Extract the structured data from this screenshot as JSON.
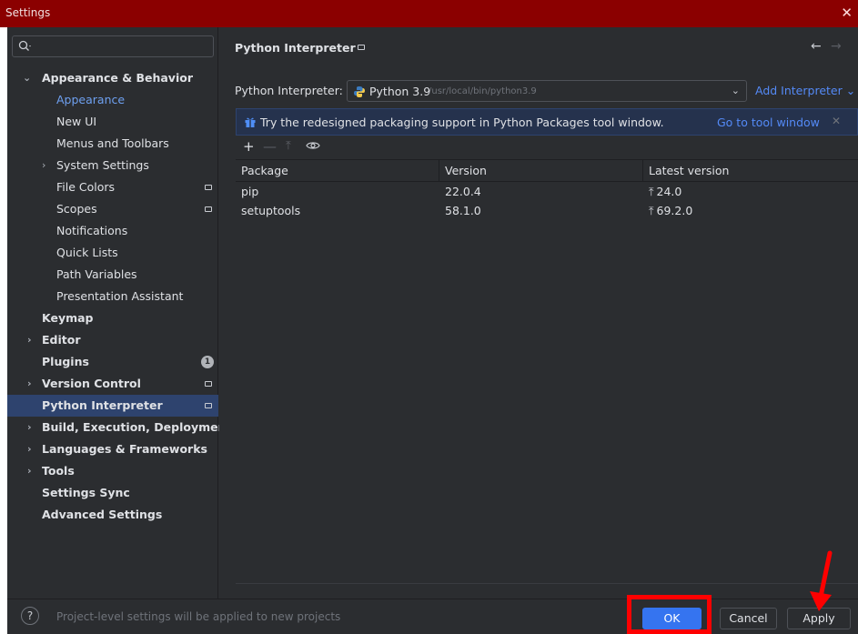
{
  "window": {
    "title": "Settings",
    "close_glyph": "✕"
  },
  "sidebar": {
    "search_placeholder": "",
    "items": [
      {
        "label": "Appearance & Behavior",
        "expanded": true
      },
      {
        "label": "Appearance",
        "active": true
      },
      {
        "label": "New UI"
      },
      {
        "label": "Menus and Toolbars"
      },
      {
        "label": "System Settings",
        "collapsed": true
      },
      {
        "label": "File Colors",
        "project_level": true
      },
      {
        "label": "Scopes",
        "project_level": true
      },
      {
        "label": "Notifications"
      },
      {
        "label": "Quick Lists"
      },
      {
        "label": "Path Variables"
      },
      {
        "label": "Presentation Assistant"
      },
      {
        "label": "Keymap"
      },
      {
        "label": "Editor",
        "collapsed": true
      },
      {
        "label": "Plugins",
        "badge": "1"
      },
      {
        "label": "Version Control",
        "collapsed": true,
        "project_level": true
      },
      {
        "label": "Python Interpreter",
        "selected": true,
        "project_level": true
      },
      {
        "label": "Build, Execution, Deployment",
        "collapsed": true
      },
      {
        "label": "Languages & Frameworks",
        "collapsed": true
      },
      {
        "label": "Tools",
        "collapsed": true
      },
      {
        "label": "Settings Sync"
      },
      {
        "label": "Advanced Settings"
      }
    ]
  },
  "content": {
    "title": "Python Interpreter",
    "interpreter_label": "Python Interpreter:",
    "interpreter_name": "Python 3.9",
    "interpreter_path": "/usr/local/bin/python3.9",
    "add_interpreter": "Add Interpreter",
    "banner": {
      "message": "Try the redesigned packaging support in Python Packages tool window.",
      "link": "Go to tool window"
    },
    "table": {
      "columns": [
        "Package",
        "Version",
        "Latest version"
      ],
      "rows": [
        {
          "package": "pip",
          "version": "22.0.4",
          "latest": "24.0"
        },
        {
          "package": "setuptools",
          "version": "58.1.0",
          "latest": "69.2.0"
        }
      ]
    }
  },
  "footer": {
    "help_glyph": "?",
    "note": "Project-level settings will be applied to new projects",
    "ok": "OK",
    "cancel": "Cancel",
    "apply": "Apply"
  },
  "colors": {
    "accent": "#3574f0",
    "link": "#548af7",
    "annotation": "#ff0000",
    "titlebar": "#8b0000"
  }
}
